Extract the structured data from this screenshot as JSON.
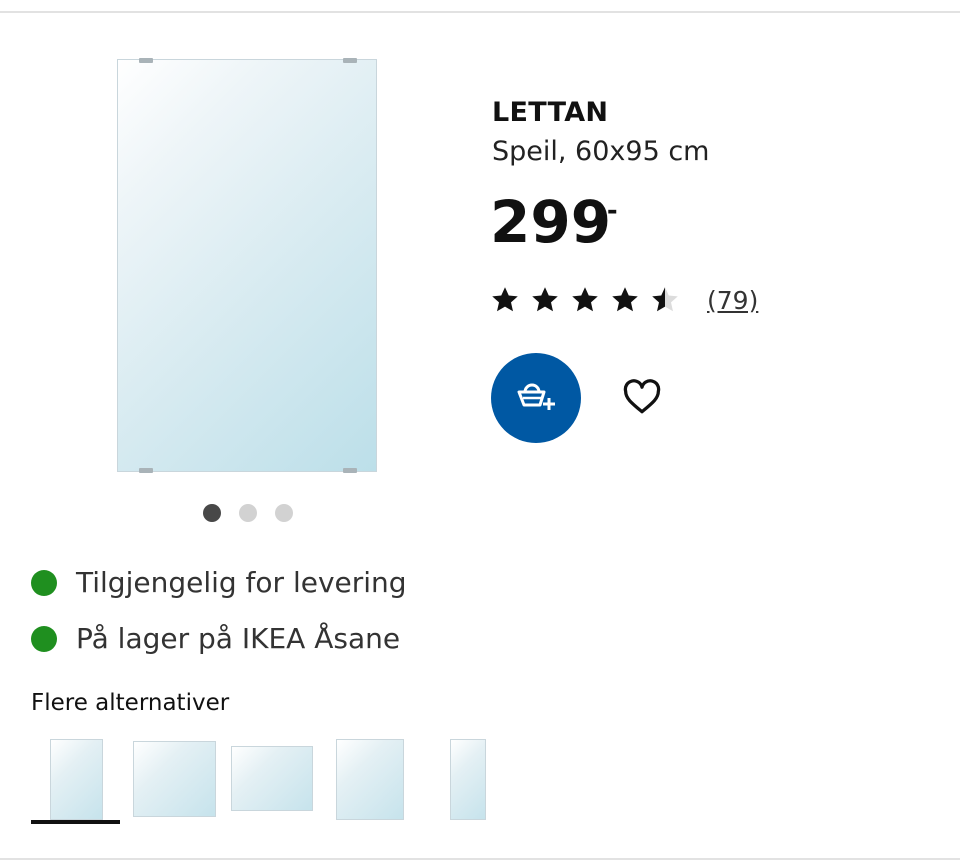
{
  "product": {
    "name": "LETTAN",
    "description": "Speil, 60x95 cm",
    "price": "299",
    "price_suffix": ",-",
    "rating": 4.5,
    "rating_max": 5,
    "review_count": "(79)"
  },
  "gallery": {
    "dot_count": 3,
    "active_dot": 0
  },
  "availability": [
    {
      "text": "Tilgjengelig for levering",
      "status_color": "#1f8f1f"
    },
    {
      "text": "På lager på IKEA Åsane",
      "status_color": "#1f8f1f"
    }
  ],
  "alternatives": {
    "heading": "Flere alternativer",
    "selected_index": 0
  },
  "actions": {
    "cart_icon": "add-to-cart-basket-icon",
    "favorite_icon": "heart-icon"
  },
  "colors": {
    "brand_blue": "#0058a3",
    "available_green": "#1f8f1f"
  }
}
